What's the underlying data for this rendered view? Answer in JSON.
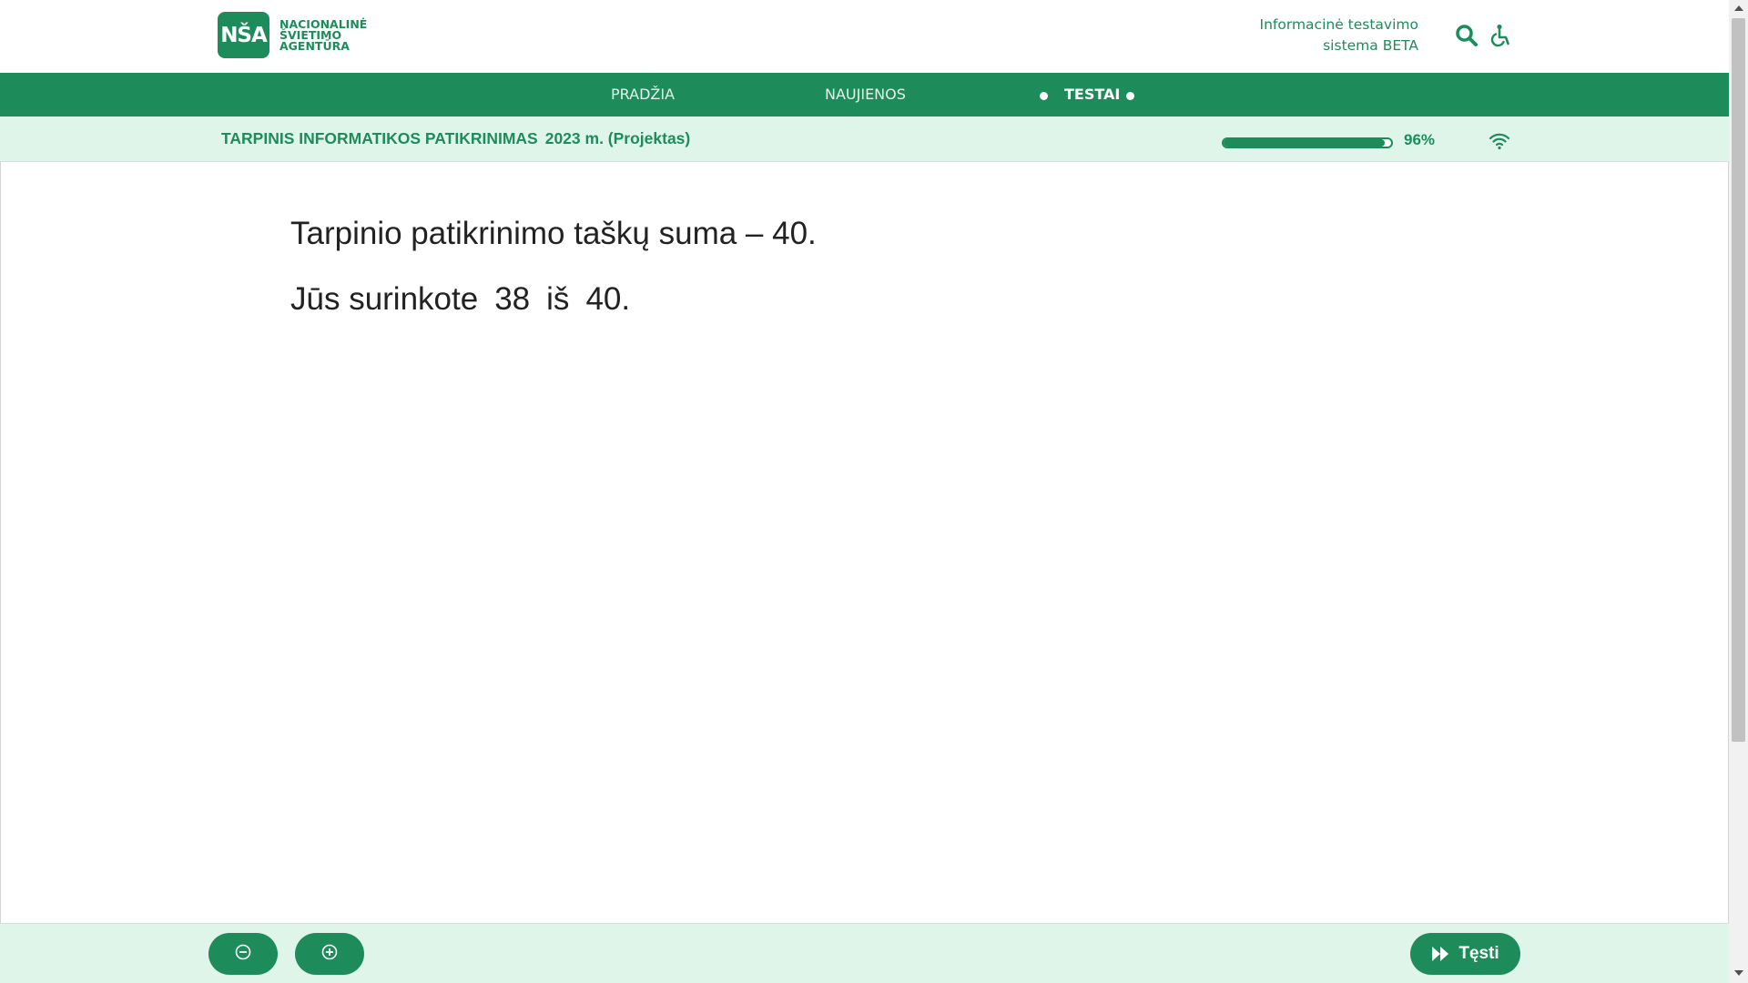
{
  "brand": {
    "badge": "NŠA",
    "line1": "NACIONALINĖ",
    "line2": "ŠVIETIMO",
    "line3": "AGENTŪRA",
    "color": "#1e8c5a"
  },
  "header": {
    "system_line1": "Informacinė testavimo",
    "system_line2": "sistema BETA",
    "icons": [
      "search-icon",
      "accessibility-icon"
    ]
  },
  "nav": {
    "items": [
      {
        "label": "PRADŽIA",
        "active": false
      },
      {
        "label": "NAUJIENOS",
        "active": false
      },
      {
        "label": "TESTAI",
        "active": true
      }
    ]
  },
  "exam": {
    "title": "TARPINIS INFORMATIKOS PATIKRINIMAS",
    "year": "2023 m. (Projektas)",
    "progress_percent": 96,
    "progress_label": "96%",
    "connection_icon": "wifi-icon"
  },
  "result": {
    "line1": "Tarpinio patikrinimo taškų suma – 40.",
    "line2_prefix": "Jūs surinkote",
    "score": "38",
    "of": "iš",
    "total": "40."
  },
  "footer": {
    "zoom_out_icon": "zoom-out-icon",
    "zoom_in_icon": "zoom-in-icon",
    "continue_label": "Tęsti"
  }
}
